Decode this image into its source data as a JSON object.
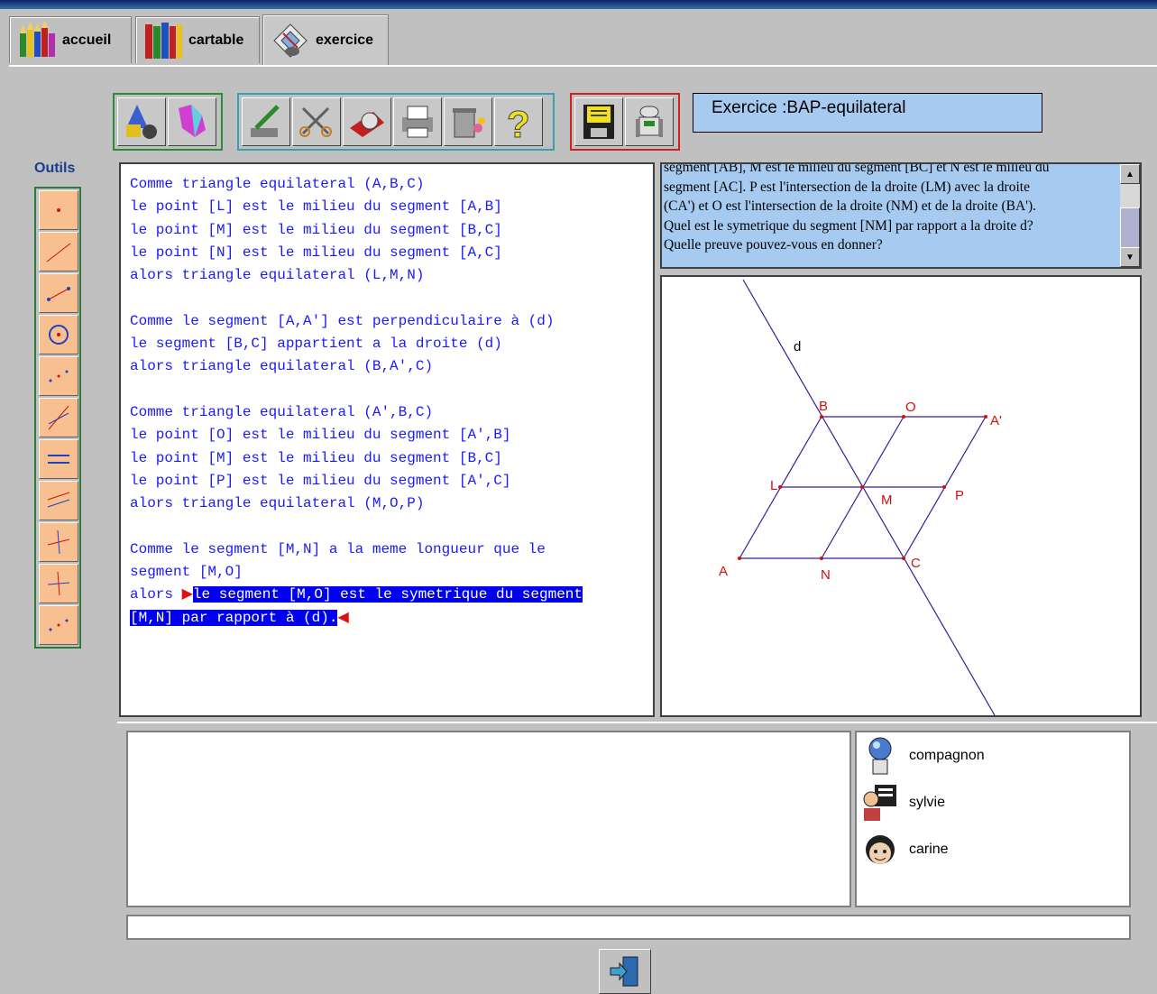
{
  "tabs": [
    {
      "label": "accueil",
      "icon": "crayons-icon"
    },
    {
      "label": "cartable",
      "icon": "books-icon"
    },
    {
      "label": "exercice",
      "icon": "exercise-icon",
      "active": true
    }
  ],
  "toolbar": {
    "groups": [
      {
        "color": "#2e8b3c",
        "buttons": [
          "shapes-icon",
          "crystal-icon"
        ]
      },
      {
        "color": "#3aa0b0",
        "buttons": [
          "edit-pen-icon",
          "scissors-icon",
          "tape-icon",
          "printer-icon",
          "trash-icon",
          "help-icon"
        ]
      },
      {
        "color": "#d02020",
        "buttons": [
          "save-disk-icon",
          "robot-icon"
        ]
      }
    ]
  },
  "exercise_title": "Exercice :BAP-equilateral",
  "tools": {
    "label": "Outils",
    "items": [
      "point-tool-icon",
      "line-tool-icon",
      "segment-tool-icon",
      "circle-tool-icon",
      "points-tool-icon",
      "bisector-tool-icon",
      "parallel-tool-icon",
      "parallel-lines-tool-icon",
      "perpendicular-tool-icon",
      "perpendicular-line-tool-icon",
      "midpoint-tool-icon"
    ]
  },
  "proof": {
    "lines": [
      "Comme triangle equilateral (A,B,C)",
      "le point [L] est le milieu du segment [A,B]",
      "le point [M] est le milieu du segment [B,C]",
      "le point [N] est le milieu du segment [A,C]",
      "alors triangle equilateral (L,M,N)",
      "",
      "Comme le segment [A,A'] est perpendiculaire à (d)",
      "le segment [B,C] appartient a la droite (d)",
      "alors triangle equilateral (B,A',C)",
      "",
      "Comme triangle equilateral (A',B,C)",
      "le point [O] est le milieu du segment [A',B]",
      "le point [M] est le milieu du segment [B,C]",
      "le point [P] est le milieu du segment [A',C]",
      "alors triangle equilateral (M,O,P)",
      "",
      "Comme le segment [M,N] a la meme longueur que le",
      "segment [M,O]"
    ],
    "conclusion_prefix": "alors ",
    "conclusion_1": "le segment [M,O] est le symetrique du segment",
    "conclusion_2": "[M,N] par rapport à (d).",
    "marker_start": "▶",
    "marker_end": "◀"
  },
  "statement": {
    "lines": [
      "segment [AB], M est le milieu du segment [BC] et N est le milieu du",
      "segment [AC]. P est l'intersection de la droite (LM) avec la droite",
      "(CA') et O est l'intersection de la droite (NM) et de la droite (BA').",
      "Quel est le symetrique du segment [NM] par rapport a la droite d?",
      "Quelle preuve pouvez-vous en donner?"
    ]
  },
  "figure": {
    "labels": {
      "d": "d",
      "B": "B",
      "O": "O",
      "A2": "A'",
      "L": "L",
      "M": "M",
      "P": "P",
      "A": "A",
      "N": "N",
      "C": "C"
    },
    "point_color": "#d01010",
    "line_color": "#3a1a9a"
  },
  "participants": [
    {
      "name": "compagnon",
      "icon": "companion-avatar-icon"
    },
    {
      "name": "sylvie",
      "icon": "teacher-avatar-icon"
    },
    {
      "name": "carine",
      "icon": "student-avatar-icon"
    }
  ],
  "chat": {
    "messages": [],
    "input_value": ""
  },
  "exit_button": {
    "icon": "exit-door-icon"
  }
}
